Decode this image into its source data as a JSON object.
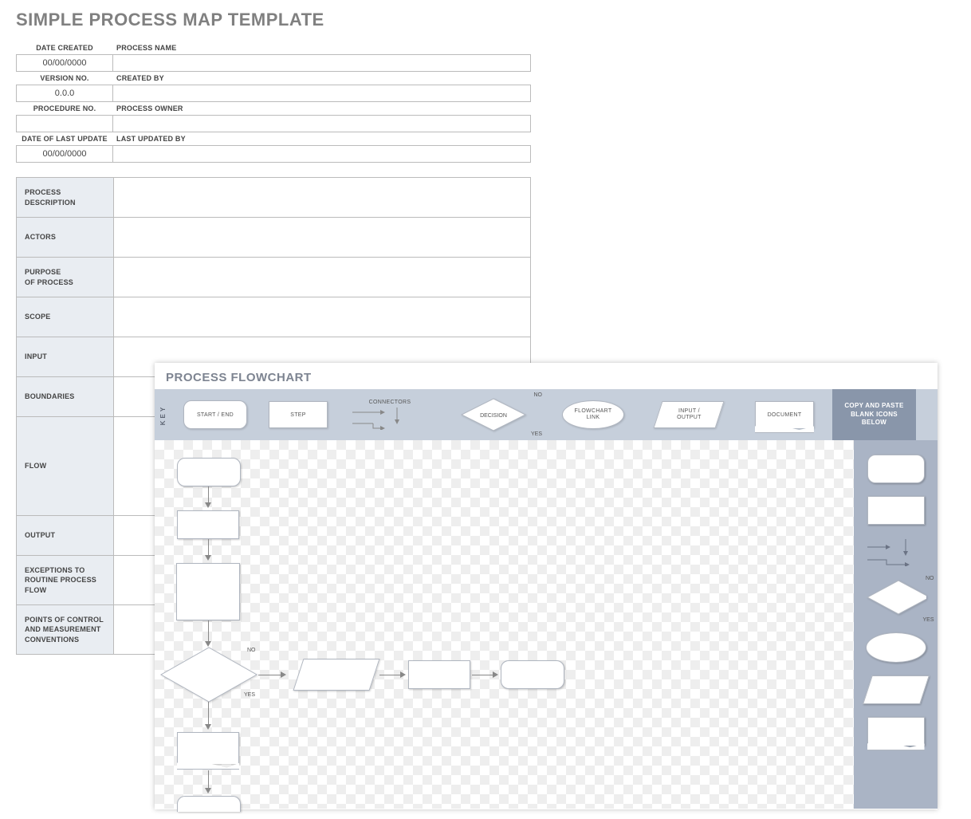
{
  "title": "SIMPLE PROCESS MAP TEMPLATE",
  "header": {
    "fields": [
      {
        "left_label": "DATE CREATED",
        "left_value": "00/00/0000",
        "right_label": "PROCESS NAME",
        "right_value": ""
      },
      {
        "left_label": "VERSION NO.",
        "left_value": "0.0.0",
        "right_label": "CREATED BY",
        "right_value": ""
      },
      {
        "left_label": "PROCEDURE NO.",
        "left_value": "",
        "right_label": "PROCESS OWNER",
        "right_value": ""
      },
      {
        "left_label": "DATE OF LAST UPDATE",
        "left_value": "00/00/0000",
        "right_label": "LAST UPDATED BY",
        "right_value": ""
      }
    ]
  },
  "details": [
    {
      "label": "PROCESS\nDESCRIPTION",
      "value": "",
      "h": ""
    },
    {
      "label": "ACTORS",
      "value": "",
      "h": ""
    },
    {
      "label": "PURPOSE\nOF PROCESS",
      "value": "",
      "h": ""
    },
    {
      "label": "SCOPE",
      "value": "",
      "h": ""
    },
    {
      "label": "INPUT",
      "value": "",
      "h": ""
    },
    {
      "label": "BOUNDARIES",
      "value": "",
      "h": ""
    },
    {
      "label": "FLOW",
      "value": "",
      "h": "tall"
    },
    {
      "label": "OUTPUT",
      "value": "",
      "h": ""
    },
    {
      "label": "EXCEPTIONS TO\nROUTINE PROCESS FLOW",
      "value": "",
      "h": "med"
    },
    {
      "label": "POINTS OF CONTROL\nAND MEASUREMENT\nCONVENTIONS",
      "value": "",
      "h": "med"
    }
  ],
  "flowchart": {
    "title": "PROCESS FLOWCHART",
    "key_label": "KEY",
    "legend": {
      "start_end": "START / END",
      "step": "STEP",
      "connectors": "CONNECTORS",
      "decision": "DECISION",
      "decision_no": "NO",
      "decision_yes": "YES",
      "flowchart_link": "FLOWCHART\nLINK",
      "input_output": "INPUT /\nOUTPUT",
      "document": "DOCUMENT",
      "copy_paste": "COPY AND PASTE BLANK ICONS BELOW"
    },
    "canvas": {
      "decision_no": "NO",
      "decision_yes": "YES"
    },
    "sidebar": {
      "decision_no": "NO",
      "decision_yes": "YES"
    }
  }
}
